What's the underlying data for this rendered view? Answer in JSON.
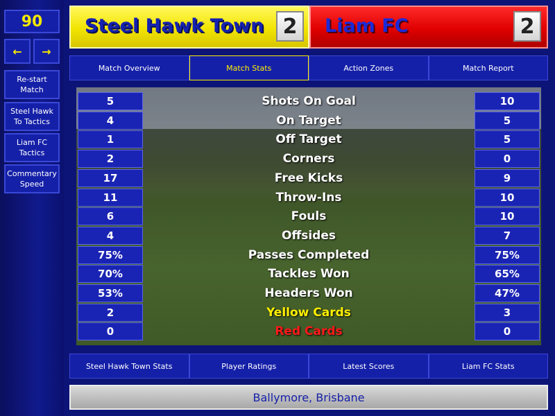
{
  "sidebar": {
    "clock": "90",
    "prev_arrow": "←",
    "next_arrow": "→",
    "buttons": [
      {
        "label": "Re-start Match"
      },
      {
        "label": "Steel Hawk To Tactics"
      },
      {
        "label": "Liam FC Tactics"
      },
      {
        "label": "Commentary Speed"
      }
    ]
  },
  "match": {
    "home_team": "Steel Hawk Town",
    "home_score": "2",
    "away_team": "Liam FC",
    "away_score": "2"
  },
  "top_tabs": [
    {
      "label": "Match Overview"
    },
    {
      "label": "Match Stats"
    },
    {
      "label": "Action Zones"
    },
    {
      "label": "Match Report"
    }
  ],
  "stats": [
    {
      "label": "Shots On Goal",
      "home": "5",
      "away": "10"
    },
    {
      "label": "On Target",
      "home": "4",
      "away": "5"
    },
    {
      "label": "Off Target",
      "home": "1",
      "away": "5"
    },
    {
      "label": "Corners",
      "home": "2",
      "away": "0"
    },
    {
      "label": "Free Kicks",
      "home": "17",
      "away": "9"
    },
    {
      "label": "Throw-Ins",
      "home": "11",
      "away": "10"
    },
    {
      "label": "Fouls",
      "home": "6",
      "away": "10"
    },
    {
      "label": "Offsides",
      "home": "4",
      "away": "7"
    },
    {
      "label": "Passes Completed",
      "home": "75%",
      "away": "75%"
    },
    {
      "label": "Tackles Won",
      "home": "70%",
      "away": "65%"
    },
    {
      "label": "Headers Won",
      "home": "53%",
      "away": "47%"
    },
    {
      "label": "Yellow Cards",
      "home": "2",
      "away": "3"
    },
    {
      "label": "Red Cards",
      "home": "0",
      "away": "0"
    }
  ],
  "bottom_tabs": [
    {
      "label": "Steel Hawk Town Stats"
    },
    {
      "label": "Player Ratings"
    },
    {
      "label": "Latest Scores"
    },
    {
      "label": "Liam FC Stats"
    }
  ],
  "venue": "Ballymore, Brisbane",
  "colors": {
    "yellow_cards_label": "#ffef00",
    "red_cards_label": "#ff1a1a",
    "active_tab": "#ffef00"
  }
}
